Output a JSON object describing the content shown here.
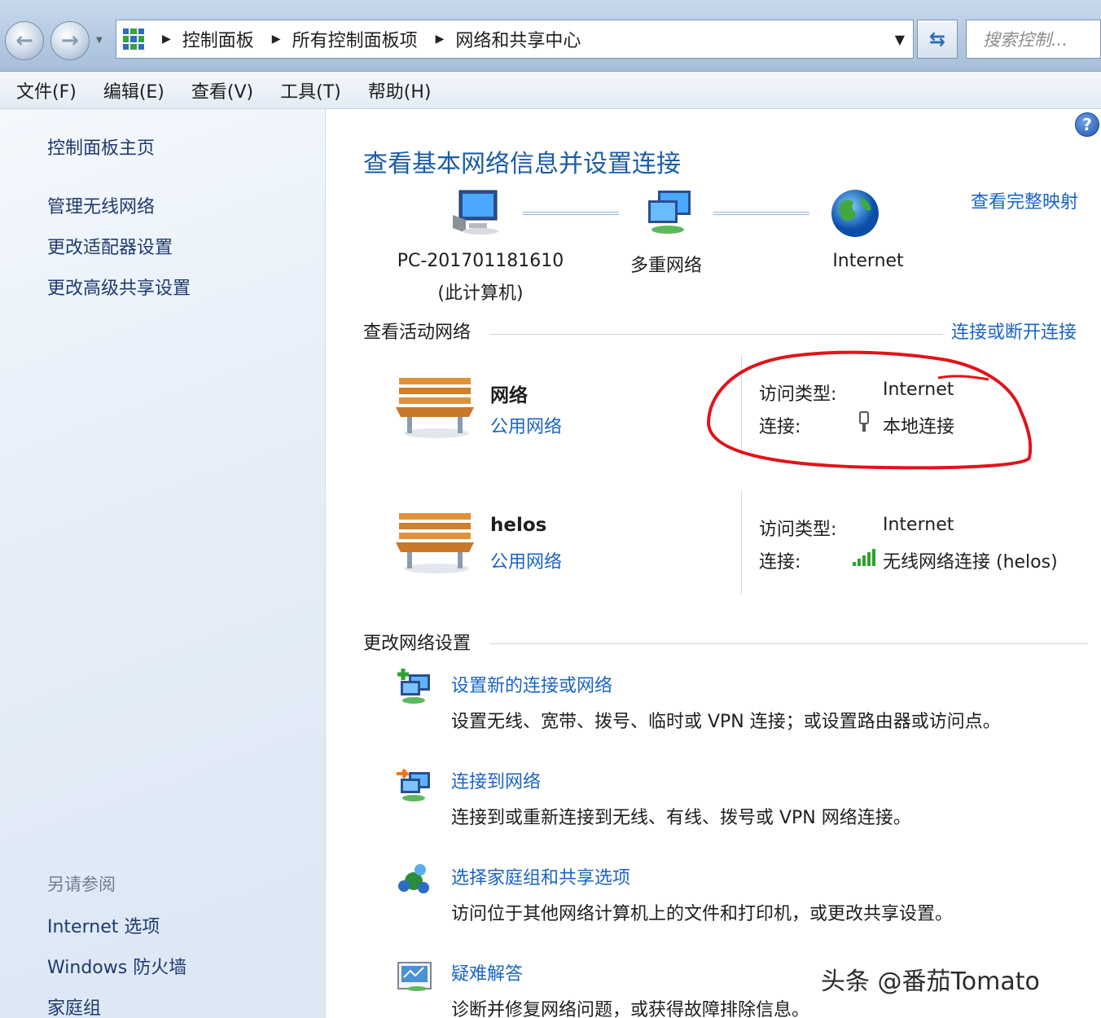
{
  "address_bar": {
    "breadcrumbs": [
      "控制面板",
      "所有控制面板项",
      "网络和共享中心"
    ],
    "search_placeholder": "搜索控制..."
  },
  "menu": [
    "文件(F)",
    "编辑(E)",
    "查看(V)",
    "工具(T)",
    "帮助(H)"
  ],
  "sidebar": {
    "home": "控制面板主页",
    "links": [
      "管理无线网络",
      "更改适配器设置",
      "更改高级共享设置"
    ],
    "see_also_heading": "另请参阅",
    "see_also": [
      "Internet 选项",
      "Windows 防火墙",
      "家庭组"
    ]
  },
  "main": {
    "title": "查看基本网络信息并设置连接",
    "view_full_map": "查看完整映射",
    "map": {
      "computer_name": "PC-201701181610",
      "computer_sub": "(此计算机)",
      "middle": "多重网络",
      "internet": "Internet"
    },
    "active_networks_heading": "查看活动网络",
    "connect_disconnect": "连接或断开连接",
    "networks": [
      {
        "name": "网络",
        "type": "公用网络",
        "access_label": "访问类型:",
        "access_value": "Internet",
        "conn_label": "连接:",
        "conn_value": "本地连接"
      },
      {
        "name": "helos",
        "type": "公用网络",
        "access_label": "访问类型:",
        "access_value": "Internet",
        "conn_label": "连接:",
        "conn_value": "无线网络连接 (helos)"
      }
    ],
    "change_settings_heading": "更改网络设置",
    "tasks": [
      {
        "title": "设置新的连接或网络",
        "desc": "设置无线、宽带、拨号、临时或 VPN 连接；或设置路由器或访问点。"
      },
      {
        "title": "连接到网络",
        "desc": "连接到或重新连接到无线、有线、拨号或 VPN 网络连接。"
      },
      {
        "title": "选择家庭组和共享选项",
        "desc": "访问位于其他网络计算机上的文件和打印机，或更改共享设置。"
      },
      {
        "title": "疑难解答",
        "desc": "诊断并修复网络问题，或获得故障排除信息。"
      }
    ]
  },
  "watermark": "头条 @番茄Tomato",
  "colors": {
    "link": "#1a64c4",
    "title": "#1b5ba8",
    "annotation": "#e0141a"
  }
}
